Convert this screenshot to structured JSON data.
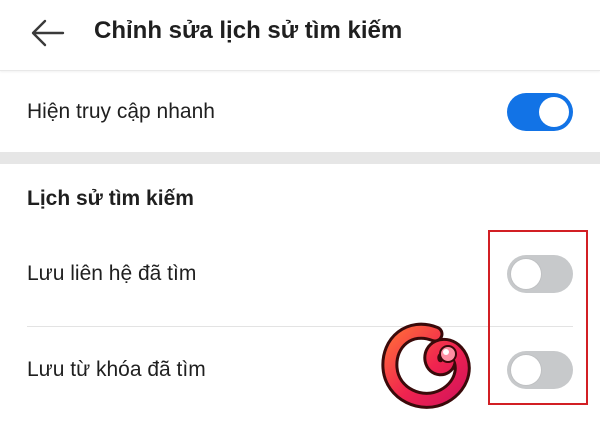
{
  "header": {
    "back_icon": "arrow-left-icon",
    "title": "Chỉnh sửa lịch sử tìm kiếm"
  },
  "quick_access": {
    "label": "Hiện truy cập nhanh",
    "enabled": true
  },
  "search_history": {
    "heading": "Lịch sử tìm kiếm",
    "items": [
      {
        "label": "Lưu liên hệ đã tìm",
        "enabled": false
      },
      {
        "label": "Lưu từ khóa đã tìm",
        "enabled": false
      }
    ]
  },
  "colors": {
    "toggle_on": "#1273e6",
    "toggle_off": "#c7c9cb",
    "highlight": "#d21f24",
    "section_bg": "#e6e6e6"
  }
}
